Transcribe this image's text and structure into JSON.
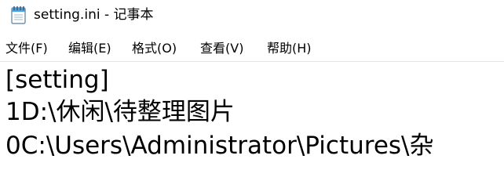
{
  "window": {
    "title": "setting.ini - 记事本",
    "icon": "notepad-icon"
  },
  "menubar": {
    "items": [
      {
        "label": "文件(F)"
      },
      {
        "label": "编辑(E)"
      },
      {
        "label": "格式(O)"
      },
      {
        "label": "查看(V)"
      },
      {
        "label": "帮助(H)"
      }
    ]
  },
  "editor": {
    "lines": [
      "[setting]",
      "1D:\\休闲\\待整理图片",
      "0C:\\Users\\Administrator\\Pictures\\杂"
    ]
  }
}
